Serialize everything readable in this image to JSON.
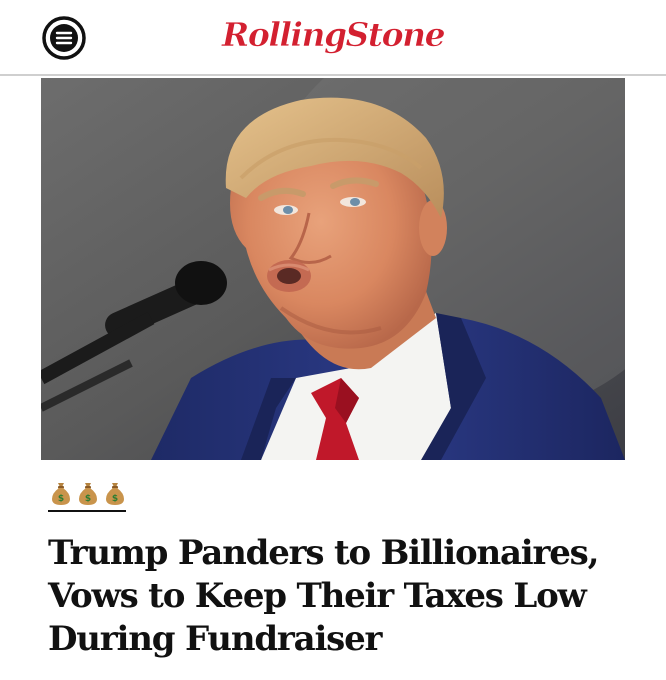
{
  "header": {
    "brand": "RollingStone",
    "menu_icon": "hamburger-menu-icon",
    "brand_color": "#d32030"
  },
  "article": {
    "category_icon": "money-bag-icon",
    "category_icon_count": 3,
    "headline_lines": [
      "Trump Panders to Billionaires,",
      "Vows to Keep Their Taxes Low",
      "During Fundraiser"
    ]
  }
}
